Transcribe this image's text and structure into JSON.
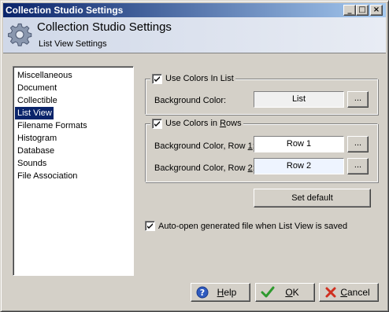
{
  "window": {
    "title": "Collection Studio Settings",
    "controls": {
      "minimize": "_",
      "maximize": "□",
      "close": "×"
    }
  },
  "header": {
    "title": "Collection Studio Settings",
    "subtitle": "List View Settings",
    "icon": "gear-icon"
  },
  "categories": {
    "items": [
      "Miscellaneous",
      "Document",
      "Collectible",
      "List View",
      "Filename Formats",
      "Histogram",
      "Database",
      "Sounds",
      "File Association"
    ],
    "selected": "List View"
  },
  "list_colors": {
    "checkbox_label": "Use Colors In List",
    "checked": true,
    "bg_label": "Background Color:",
    "bg_value": "List",
    "bg_color": "#f0f0f0",
    "browse_label": "..."
  },
  "row_colors": {
    "checkbox_label_pre": "Use Colors in ",
    "checkbox_label_accel": "R",
    "checkbox_label_post": "ows",
    "checked": true,
    "row1_label_pre": "Background Color, Row ",
    "row1_label_accel": "1",
    "row1_label_post": ":",
    "row1_value": "Row 1",
    "row1_color": "#ffffff",
    "row2_label_pre": "Background Color, Row ",
    "row2_label_accel": "2",
    "row2_label_post": ":",
    "row2_value": "Row 2",
    "row2_color": "#eef4ff",
    "browse_label": "..."
  },
  "set_default_label": "Set default",
  "auto_open": {
    "label": "Auto-open generated file when List View is saved",
    "checked": true
  },
  "buttons": {
    "help": {
      "accel": "H",
      "rest": "elp",
      "icon": "help-icon"
    },
    "ok": {
      "accel": "O",
      "rest": "K",
      "icon": "check-icon"
    },
    "cancel": {
      "accel": "C",
      "rest": "ancel",
      "icon": "cancel-icon"
    }
  }
}
